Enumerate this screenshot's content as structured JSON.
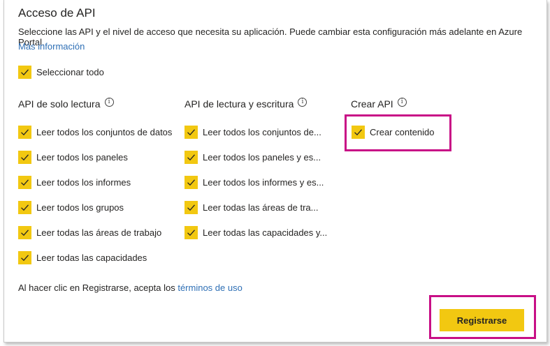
{
  "header": {
    "title": "Acceso de API",
    "description": "Seleccione las API y el nivel de acceso que necesita su aplicación. Puede cambiar esta configuración más adelante en Azure Portal.",
    "more_info_link": "Más información"
  },
  "select_all": {
    "label": "Seleccionar todo",
    "checked": true
  },
  "columns": {
    "readonly": {
      "heading": "API de solo lectura",
      "items": [
        "Leer todos los conjuntos de datos",
        "Leer todos los paneles",
        "Leer todos los informes",
        "Leer todos los grupos",
        "Leer todas las áreas de trabajo",
        "Leer todas las capacidades"
      ]
    },
    "readwrite": {
      "heading": "API de lectura y escritura",
      "items": [
        "Leer todos los conjuntos de...",
        "Leer todos los paneles y es...",
        "Leer todos los informes y es...",
        "Leer todas las áreas de tra...",
        "Leer todas las capacidades y..."
      ]
    },
    "create": {
      "heading": "Crear API",
      "items": [
        "Crear contenido"
      ]
    }
  },
  "footer": {
    "terms_prefix": "Al hacer clic en Registrarse, acepta los ",
    "terms_link": "términos de uso",
    "register_button": "Registrarse"
  },
  "colors": {
    "accent_yellow": "#f2c811",
    "highlight_magenta": "#c80f86",
    "link_blue": "#2e6fb5"
  },
  "icons": {
    "checkbox": "checkmark-icon",
    "info": "info-icon"
  }
}
